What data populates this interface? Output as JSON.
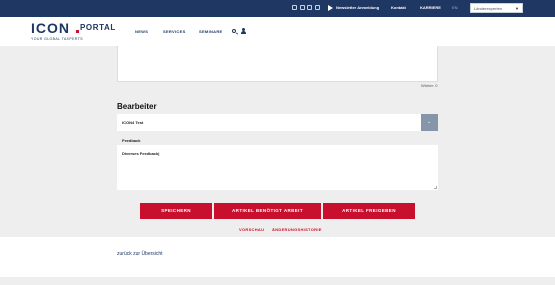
{
  "topbar": {
    "social_icons": [
      "facebook-icon",
      "instagram-icon",
      "linkedin-icon",
      "youtube-icon"
    ],
    "newsletter_label": "Newsletter Anmeldung",
    "contact_label": "Kontakt",
    "career_label": "KARRIERE",
    "language_label": "EN",
    "country_select_value": "Länderexperten"
  },
  "header": {
    "logo_text": "ICON",
    "logo_portal": "PORTAL",
    "logo_tagline": "YOUR GLOBAL TAXPERTS",
    "nav": [
      "NEWS",
      "SERVICES",
      "SEMINARE"
    ]
  },
  "form": {
    "counter": "Wörter: 0",
    "bearbeiter_title": "Bearbeiter",
    "bearbeiter_value": "ICON4 Test",
    "feedback_label": "Feedback",
    "feedback_value": "Diverses Feedback|"
  },
  "actions": {
    "save": "SPEICHERN",
    "needs_work": "ARTIKEL BENÖTIGT ARBEIT",
    "release": "ARTIKEL FREIGEBEN",
    "preview": "VORSCHAU",
    "history": "ÄNDERUNGSHISTORIE"
  },
  "footer": {
    "back_link": "zurück zur Übersicht"
  },
  "colors": {
    "navy": "#1f3763",
    "red": "#c8102e",
    "select_button": "#8496a8",
    "page_bg": "#eeeeee"
  }
}
